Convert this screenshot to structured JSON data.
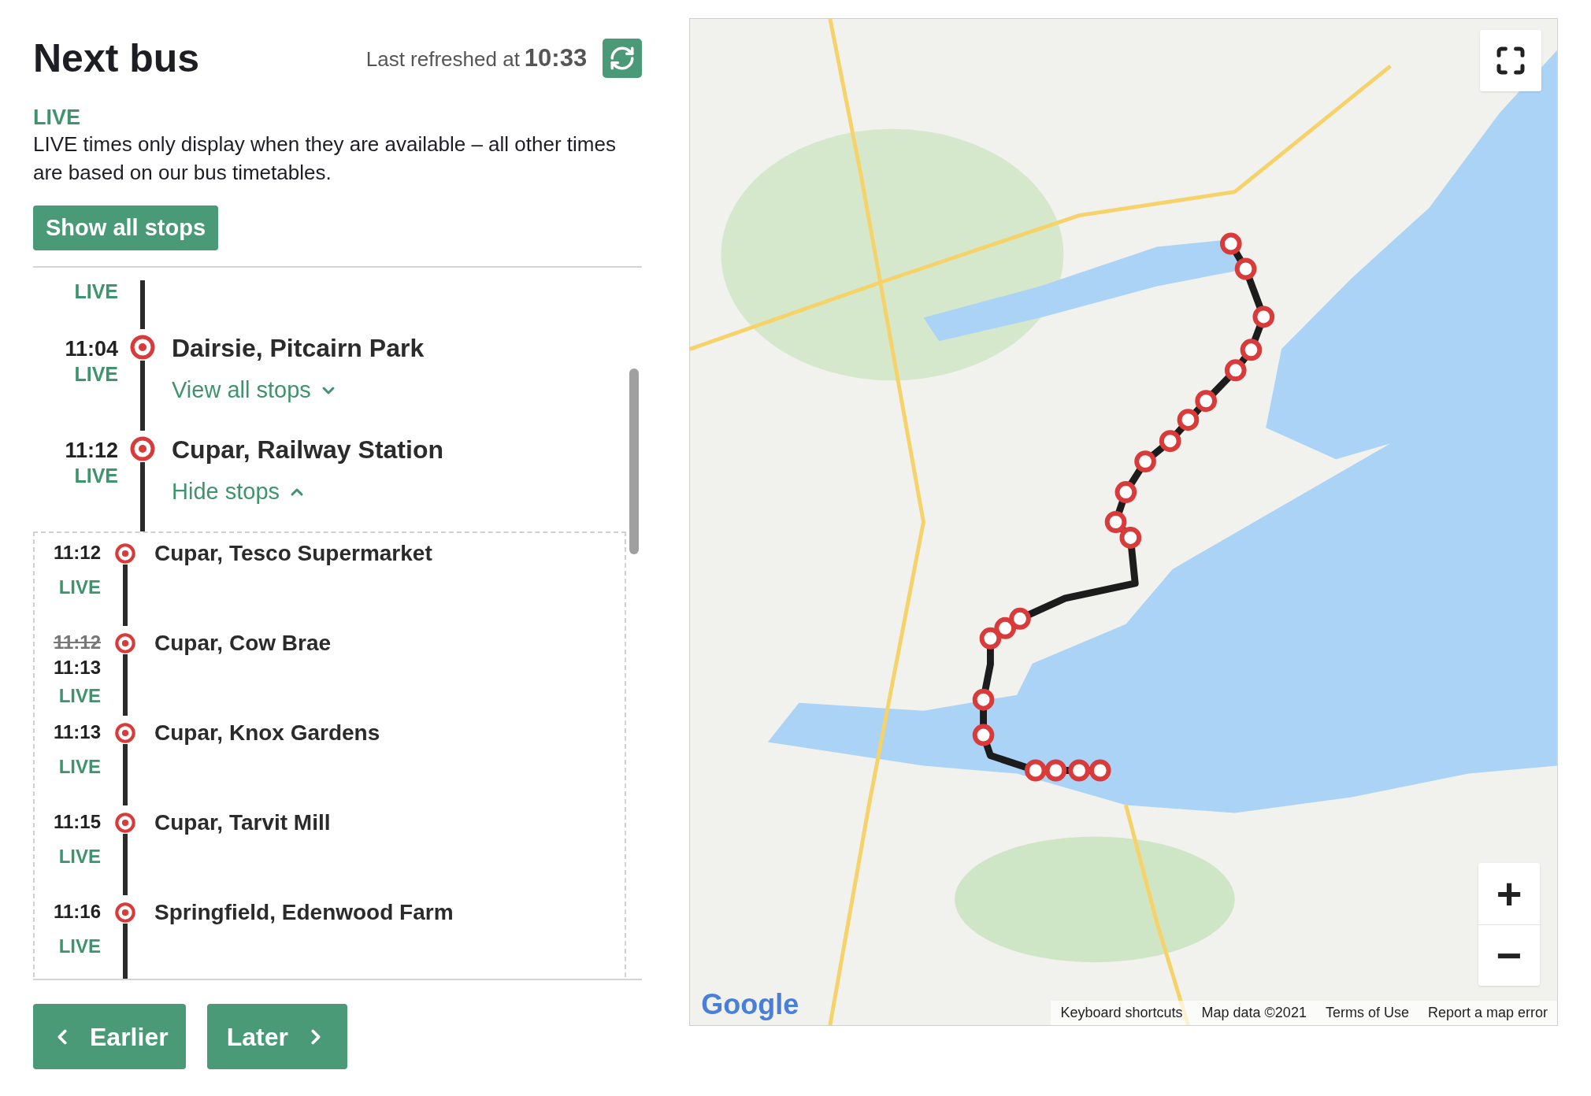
{
  "header": {
    "title": "Next bus",
    "refreshed_label": "Last refreshed at",
    "refreshed_time": "10:33"
  },
  "live_notice": {
    "badge": "LIVE",
    "text": "LIVE times only display when they are available – all other times are based on our bus timetables."
  },
  "show_all_stops": "Show all stops",
  "main_stops": [
    {
      "live": "LIVE"
    },
    {
      "time": "11:04",
      "live": "LIVE",
      "name": "Dairsie, Pitcairn Park",
      "link": {
        "label": "View all stops",
        "expanded": false
      }
    },
    {
      "time": "11:12",
      "live": "LIVE",
      "name": "Cupar, Railway Station",
      "link": {
        "label": "Hide stops",
        "expanded": true
      }
    }
  ],
  "intermediate_stops": [
    {
      "time": "11:12",
      "live": "LIVE",
      "name": "Cupar, Tesco Supermarket"
    },
    {
      "previous_time": "11:12",
      "time": "11:13",
      "live": "LIVE",
      "name": "Cupar, Cow Brae"
    },
    {
      "time": "11:13",
      "live": "LIVE",
      "name": "Cupar, Knox Gardens"
    },
    {
      "time": "11:15",
      "live": "LIVE",
      "name": "Cupar, Tarvit Mill"
    },
    {
      "time": "11:16",
      "live": "LIVE",
      "name": "Springfield, Edenwood Farm"
    }
  ],
  "pager": {
    "earlier": "Earlier",
    "later": "Later"
  },
  "map": {
    "kind": "picture",
    "logo": "Google",
    "zoom_in": "+",
    "zoom_out": "−",
    "attribution": [
      "Keyboard shortcuts",
      "Map data ©2021",
      "Terms of Use",
      "Report a map error"
    ]
  }
}
